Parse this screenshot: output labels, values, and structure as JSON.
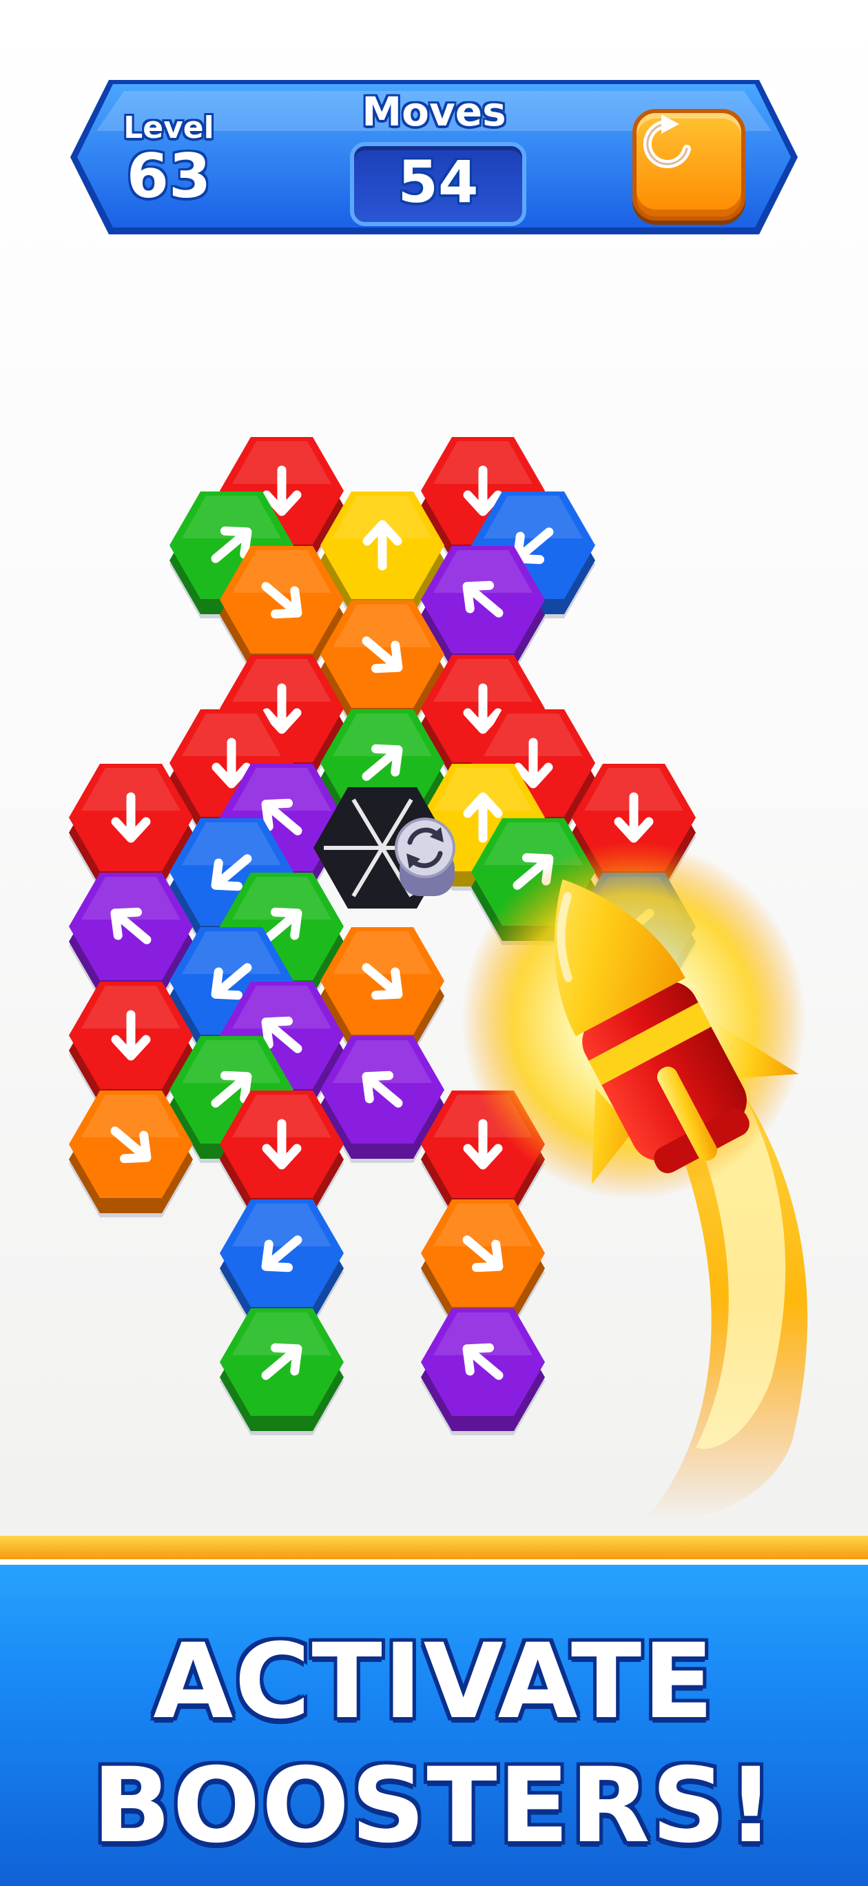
{
  "hud": {
    "level_label": "Level",
    "level_value": "63",
    "moves_label": "Moves",
    "moves_value": "54",
    "restart_icon": "restart-icon"
  },
  "board": {
    "colors": {
      "red": "#f01818",
      "green": "#1dba1d",
      "blue": "#1a6af0",
      "yellow": "#ffd000",
      "orange": "#ff7a00",
      "purple": "#8a1ee0"
    },
    "center_icon": "shuffle-icon",
    "tiles": [
      {
        "q": 3,
        "r": 0,
        "color": "red",
        "dir": "down"
      },
      {
        "q": 7,
        "r": 0,
        "color": "red",
        "dir": "down"
      },
      {
        "q": 2,
        "r": 1,
        "color": "green",
        "dir": "up-right"
      },
      {
        "q": 5,
        "r": 1,
        "color": "yellow",
        "dir": "up"
      },
      {
        "q": 8,
        "r": 1,
        "color": "blue",
        "dir": "down-left"
      },
      {
        "q": 3,
        "r": 2,
        "color": "orange",
        "dir": "down-right"
      },
      {
        "q": 7,
        "r": 2,
        "color": "purple",
        "dir": "up-left"
      },
      {
        "q": 5,
        "r": 3,
        "color": "orange",
        "dir": "down-right"
      },
      {
        "q": 3,
        "r": 4,
        "color": "red",
        "dir": "down"
      },
      {
        "q": 7,
        "r": 4,
        "color": "red",
        "dir": "down"
      },
      {
        "q": 2,
        "r": 5,
        "color": "red",
        "dir": "down"
      },
      {
        "q": 5,
        "r": 5,
        "color": "green",
        "dir": "up-right"
      },
      {
        "q": 8,
        "r": 5,
        "color": "red",
        "dir": "down"
      },
      {
        "q": 0,
        "r": 6,
        "color": "red",
        "dir": "down"
      },
      {
        "q": 3,
        "r": 6,
        "color": "purple",
        "dir": "up-left"
      },
      {
        "q": 7,
        "r": 6,
        "color": "yellow",
        "dir": "up"
      },
      {
        "q": 10,
        "r": 6,
        "color": "red",
        "dir": "down"
      },
      {
        "q": 2,
        "r": 7,
        "color": "blue",
        "dir": "down-left"
      },
      {
        "q": 8,
        "r": 7,
        "color": "green",
        "dir": "up-right"
      },
      {
        "q": 0,
        "r": 8,
        "color": "purple",
        "dir": "up-left"
      },
      {
        "q": 3,
        "r": 8,
        "color": "green",
        "dir": "up-right"
      },
      {
        "q": 10,
        "r": 8,
        "color": "blue",
        "dir": "down-left"
      },
      {
        "q": 2,
        "r": 9,
        "color": "blue",
        "dir": "down-left"
      },
      {
        "q": 5,
        "r": 9,
        "color": "orange",
        "dir": "down-right"
      },
      {
        "q": 0,
        "r": 10,
        "color": "red",
        "dir": "down"
      },
      {
        "q": 3,
        "r": 10,
        "color": "purple",
        "dir": "up-left"
      },
      {
        "q": 2,
        "r": 11,
        "color": "green",
        "dir": "up-right"
      },
      {
        "q": 5,
        "r": 11,
        "color": "purple",
        "dir": "up-left"
      },
      {
        "q": 0,
        "r": 12,
        "color": "orange",
        "dir": "down-right"
      },
      {
        "q": 3,
        "r": 12,
        "color": "red",
        "dir": "down"
      },
      {
        "q": 7,
        "r": 12,
        "color": "red",
        "dir": "down"
      },
      {
        "q": 3,
        "r": 14,
        "color": "blue",
        "dir": "down-left"
      },
      {
        "q": 7,
        "r": 14,
        "color": "orange",
        "dir": "down-right"
      },
      {
        "q": 3,
        "r": 16,
        "color": "green",
        "dir": "up-right"
      },
      {
        "q": 7,
        "r": 16,
        "color": "purple",
        "dir": "up-left"
      }
    ]
  },
  "booster": {
    "icon": "rocket-booster-icon"
  },
  "banner": {
    "line1": "ACTIVATE",
    "line2": "BOOSTERS!"
  }
}
